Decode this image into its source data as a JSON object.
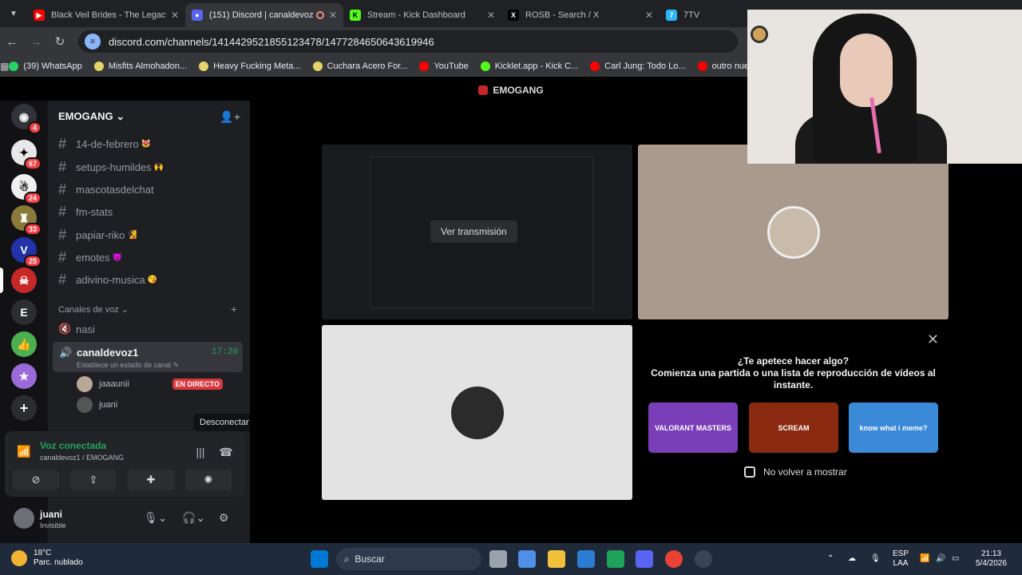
{
  "browser": {
    "tabs": [
      {
        "title": "Black Veil Brides - The Legacy",
        "icon": "youtube-icon",
        "color": "#ff0000"
      },
      {
        "title": "(151) Discord | canaldevoz1",
        "icon": "discord-icon",
        "color": "#5865f2",
        "fav_text": "151"
      },
      {
        "title": "Stream - Kick Dashboard",
        "icon": "kick-icon",
        "color": "#53fc18",
        "fav_text": "K"
      },
      {
        "title": "ROSB - Search / X",
        "icon": "x-icon",
        "color": "#000000",
        "fav_text": "X"
      },
      {
        "title": "7TV",
        "icon": "7tv-icon",
        "color": "#29b6f6",
        "fav_text": "7"
      }
    ],
    "url": "discord.com/channels/1414429521855123478/1477284650643619946",
    "bookmarks": [
      {
        "label": "(39) WhatsApp",
        "color": "#25d366"
      },
      {
        "label": "Misfits Almohadon...",
        "color": "#e6d36c"
      },
      {
        "label": "Heavy Fucking Meta...",
        "color": "#e6d36c"
      },
      {
        "label": "Cuchara Acero For...",
        "color": "#e6d36c"
      },
      {
        "label": "YouTube",
        "color": "#ff0000"
      },
      {
        "label": "Kicklet.app - Kick C...",
        "color": "#53fc18"
      },
      {
        "label": "Carl Jung: Todo Lo...",
        "color": "#ff0000"
      },
      {
        "label": "outro nueba",
        "color": "#ff0000"
      }
    ]
  },
  "discord": {
    "header_title": "EMOGANG",
    "server_name": "EMOGANG",
    "servers": [
      {
        "badge": "4",
        "color": "#313338"
      },
      {
        "badge": "67",
        "color": "#e8e8e8"
      },
      {
        "badge": "24",
        "color": "#f0f0f0"
      },
      {
        "badge": "33",
        "color": "#8a7a3a"
      },
      {
        "badge": "25",
        "color": "#2233aa"
      },
      {
        "badge": "",
        "color": "#c62828"
      },
      {
        "badge": "",
        "color": "#2b2d31",
        "letter": "E"
      },
      {
        "badge": "",
        "color": "#4caf50"
      },
      {
        "badge": "",
        "color": "#9c6ad8"
      }
    ],
    "text_channels": [
      {
        "name": "14-de-febrero",
        "emoji": "😻"
      },
      {
        "name": "setups-humildes",
        "emoji": "🙌"
      },
      {
        "name": "mascotasdelchat",
        "emoji": ""
      },
      {
        "name": "fm-stats",
        "emoji": ""
      },
      {
        "name": "papiar-riko",
        "emoji": "🧏"
      },
      {
        "name": "emotes",
        "emoji": "👿"
      },
      {
        "name": "adivino-musica",
        "emoji": "😘"
      }
    ],
    "voice_header": "Canales de voz",
    "voice_channels": [
      {
        "name": "nasi"
      }
    ],
    "active_voice": {
      "name": "canaldevoz1",
      "time": "17:20",
      "status": "Establece un estado de canal"
    },
    "members": [
      {
        "name": "jaaaunii",
        "live": "EN DIRECTO"
      },
      {
        "name": "juani",
        "live": ""
      }
    ],
    "tooltip": "Desconectar",
    "voice_panel": {
      "status": "Voz conectada",
      "sub": "canaldevoz1 / EMOGANG"
    },
    "user": {
      "name": "juani",
      "status": "Invisible"
    },
    "stream_tile": {
      "button": "Ver transmisión"
    },
    "activity": {
      "q1": "¿Te apetece hacer algo?",
      "q2": "Comienza una partida o una lista de reproducción de vídeos al instante.",
      "cards": [
        {
          "label": "VALORANT MASTERS",
          "color": "#7a3fb8"
        },
        {
          "label": "SCREAM",
          "color": "#8a2a10"
        },
        {
          "label": "know what i meme?",
          "color": "#3a8ad8"
        }
      ],
      "checkbox": "No volver a mostrar"
    }
  },
  "taskbar": {
    "weather_temp": "18°C",
    "weather_desc": "Parc. nublado",
    "search_placeholder": "Buscar",
    "lang1": "ESP",
    "lang2": "LAA",
    "time": "21:13",
    "date": "5/4/2026"
  }
}
